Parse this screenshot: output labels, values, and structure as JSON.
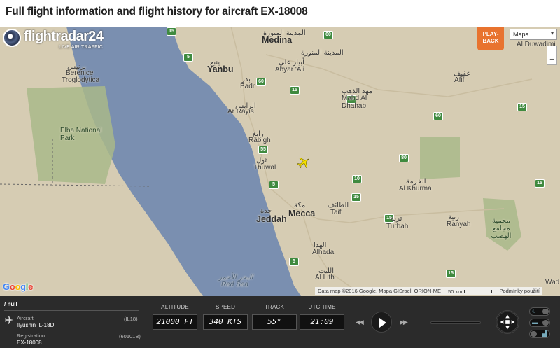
{
  "page": {
    "title": "Full flight information and flight history for aircraft EX-18008"
  },
  "logo": {
    "brand": "flightradar24",
    "tagline": "LIVE AIR TRAFFIC"
  },
  "controls": {
    "playback_line1": "PLAY-",
    "playback_line2": "BACK",
    "map_type": "Mapa",
    "zoom_in": "+",
    "zoom_out": "−"
  },
  "map": {
    "labels": {
      "medina": "Medina",
      "medina_ar": "المدينة المنورة",
      "medina_region_ar": "المدينة المنورة",
      "yanbu": "Yanbu",
      "yanbu_ar": "ينبع",
      "berenice": "Berenice",
      "berenice_ar": "برنيس",
      "troglodytica": "Troglodytica",
      "elba": "Elba National Park",
      "badr": "Badr",
      "badr_ar": "بدر",
      "abyar_ali": "Abyar 'Ali",
      "abyar_ali_ar": "أبيار علي",
      "mahd": "Mahd Al Dhahab",
      "mahd_ar": "مهد الذهب",
      "alif": "Afif",
      "alif_ar": "عفيف",
      "duwadimi": "Al Duwadimi",
      "ar_rayis": "Ar Rayis",
      "ar_rayis_ar": "الرايس",
      "rabigh": "Rabigh",
      "rabigh_ar": "رابغ",
      "thuwal": "Thuwal",
      "thuwal_ar": "ثول",
      "khurma": "Al Khurma",
      "khurma_ar": "الخرمة",
      "jeddah": "Jeddah",
      "jeddah_ar": "جدة",
      "mecca": "Mecca",
      "mecca_ar": "مكة",
      "taif": "Taif",
      "taif_ar": "الطائف",
      "turbah": "Turbah",
      "turbah_ar": "تربة",
      "ranyah": "Ranyah",
      "ranyah_ar": "رنية",
      "reserve_ar": "محمية مجامع الهضب",
      "alhada": "Alhada",
      "alhada_ar": "الهدا",
      "allith": "Al Lith",
      "allith_ar": "الليث",
      "red_sea": "Red Sea",
      "red_sea_ar": "البحر الأحمر",
      "wad": "Wad"
    },
    "google_logo": "Google",
    "attribution": "Data map ©2016 Google, Mapa GISrael, ORION-ME",
    "scale_label": "50 km",
    "terms": "Podmínky použití"
  },
  "panel": {
    "callsign": "/ null",
    "aircraft_label": "Aircraft",
    "aircraft_value": "Ilyushin IL-18D",
    "aircraft_code": "(IL18)",
    "registration_label": "Registration",
    "registration_value": "EX-18008",
    "registration_code": "(60101B)",
    "altitude_label": "ALTITUDE",
    "altitude_value": "21000 FT",
    "speed_label": "SPEED",
    "speed_value": "340 KTS",
    "track_label": "TRACK",
    "track_value": "55°",
    "utc_label": "UTC TIME",
    "utc_value": "21:09"
  }
}
